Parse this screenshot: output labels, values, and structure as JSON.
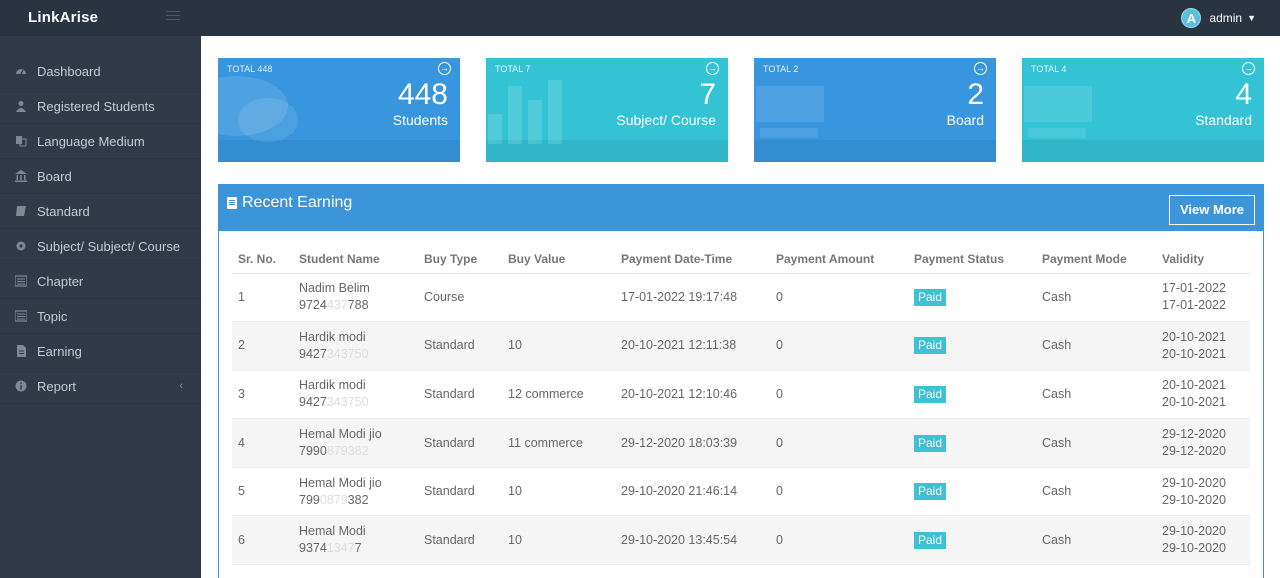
{
  "app": {
    "brand": "LinkArise",
    "user": "admin",
    "avatar_letter": "A"
  },
  "sidebar": {
    "items": [
      {
        "label": "Dashboard",
        "icon": "dashboard-icon"
      },
      {
        "label": "Registered Students",
        "icon": "user-icon"
      },
      {
        "label": "Language Medium",
        "icon": "language-icon"
      },
      {
        "label": "Board",
        "icon": "institution-icon"
      },
      {
        "label": "Standard",
        "icon": "book-icon"
      },
      {
        "label": "Subject/ Subject/ Course",
        "icon": "gear-icon"
      },
      {
        "label": "Chapter",
        "icon": "list-icon"
      },
      {
        "label": "Topic",
        "icon": "list-alt-icon"
      },
      {
        "label": "Earning",
        "icon": "file-icon"
      },
      {
        "label": "Report",
        "icon": "info-icon"
      }
    ]
  },
  "stats": [
    {
      "value": "448",
      "label": "Students",
      "footer": "TOTAL 448"
    },
    {
      "value": "7",
      "label": "Subject/ Course",
      "footer": "TOTAL 7"
    },
    {
      "value": "2",
      "label": "Board",
      "footer": "TOTAL 2"
    },
    {
      "value": "4",
      "label": "Standard",
      "footer": "TOTAL 4"
    }
  ],
  "earning": {
    "title": "Recent Earning",
    "view_more": "View More",
    "columns": [
      "Sr. No.",
      "Student Name",
      "Buy Type",
      "Buy Value",
      "Payment Date-Time",
      "Payment Amount",
      "Payment Status",
      "Payment Mode",
      "Validity"
    ],
    "rows": [
      {
        "sr": "1",
        "name": "Nadim Belim",
        "phone_a": "9724",
        "phone_b": "437",
        "phone_c": "788",
        "buy_type": "Course",
        "buy_value": "",
        "datetime": "17-01-2022 19:17:48",
        "amount": "0",
        "status": "Paid",
        "mode": "Cash",
        "valid_from": "17-01-2022",
        "valid_to": "17-01-2022"
      },
      {
        "sr": "2",
        "name": "Hardik modi",
        "phone_a": "9427",
        "phone_b": "343750",
        "phone_c": "",
        "buy_type": "Standard",
        "buy_value": "10",
        "datetime": "20-10-2021 12:11:38",
        "amount": "0",
        "status": "Paid",
        "mode": "Cash",
        "valid_from": "20-10-2021",
        "valid_to": "20-10-2021"
      },
      {
        "sr": "3",
        "name": "Hardik modi",
        "phone_a": "9427",
        "phone_b": "343750",
        "phone_c": "",
        "buy_type": "Standard",
        "buy_value": "12 commerce",
        "datetime": "20-10-2021 12:10:46",
        "amount": "0",
        "status": "Paid",
        "mode": "Cash",
        "valid_from": "20-10-2021",
        "valid_to": "20-10-2021"
      },
      {
        "sr": "4",
        "name": "Hemal Modi jio",
        "phone_a": "7990",
        "phone_b": "879382",
        "phone_c": "",
        "buy_type": "Standard",
        "buy_value": "11 commerce",
        "datetime": "29-12-2020 18:03:39",
        "amount": "0",
        "status": "Paid",
        "mode": "Cash",
        "valid_from": "29-12-2020",
        "valid_to": "29-12-2020"
      },
      {
        "sr": "5",
        "name": "Hemal Modi jio",
        "phone_a": "799",
        "phone_b": "0879",
        "phone_c": "382",
        "buy_type": "Standard",
        "buy_value": "10",
        "datetime": "29-10-2020 21:46:14",
        "amount": "0",
        "status": "Paid",
        "mode": "Cash",
        "valid_from": "29-10-2020",
        "valid_to": "29-10-2020"
      },
      {
        "sr": "6",
        "name": "Hemal Modi",
        "phone_a": "9374",
        "phone_b": "1347",
        "phone_c": "7",
        "buy_type": "Standard",
        "buy_value": "10",
        "datetime": "29-10-2020 13:45:54",
        "amount": "0",
        "status": "Paid",
        "mode": "Cash",
        "valid_from": "29-10-2020",
        "valid_to": "29-10-2020"
      }
    ]
  }
}
